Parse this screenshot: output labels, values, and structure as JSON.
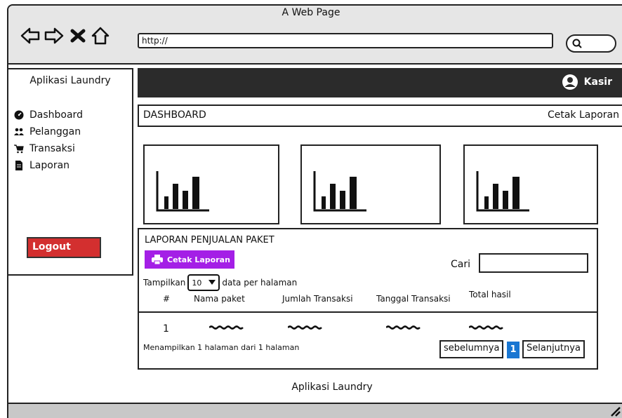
{
  "window": {
    "title": "A Web Page"
  },
  "browser": {
    "url": "http://"
  },
  "sidebar": {
    "app_name": "Aplikasi Laundry",
    "items": [
      {
        "label": "Dashboard",
        "icon": "dashboard-icon"
      },
      {
        "label": "Pelanggan",
        "icon": "users-icon"
      },
      {
        "label": "Transaksi",
        "icon": "cart-icon"
      },
      {
        "label": "Laporan",
        "icon": "file-icon"
      }
    ],
    "logout_label": "Logout"
  },
  "header": {
    "user_label": "Kasir"
  },
  "dashboard_bar": {
    "title": "DASHBOARD",
    "report_link": "Cetak Laporan"
  },
  "report": {
    "title": "LAPORAN PENJUALAN PAKET",
    "print_button": "Cetak Laporan",
    "search_label": "Cari",
    "show_prefix": "Tampilkan",
    "page_size": "10",
    "show_suffix": "data per halaman",
    "columns": [
      "#",
      "Nama paket",
      "Jumlah Transaksi",
      "Tanggal Transaksi",
      "Total hasil"
    ],
    "rows": [
      {
        "num": "1"
      }
    ],
    "info": "Menampilkan 1 halaman dari 1 halaman",
    "prev_label": "sebelumnya",
    "current_page": "1",
    "next_label": "Selanjutnya"
  },
  "footer": {
    "text": "Aplikasi Laundry"
  },
  "colors": {
    "print_button": "#a41fe6",
    "logout": "#d32f2f",
    "current_page": "#1976d2",
    "topbar": "#2b2b2b"
  }
}
